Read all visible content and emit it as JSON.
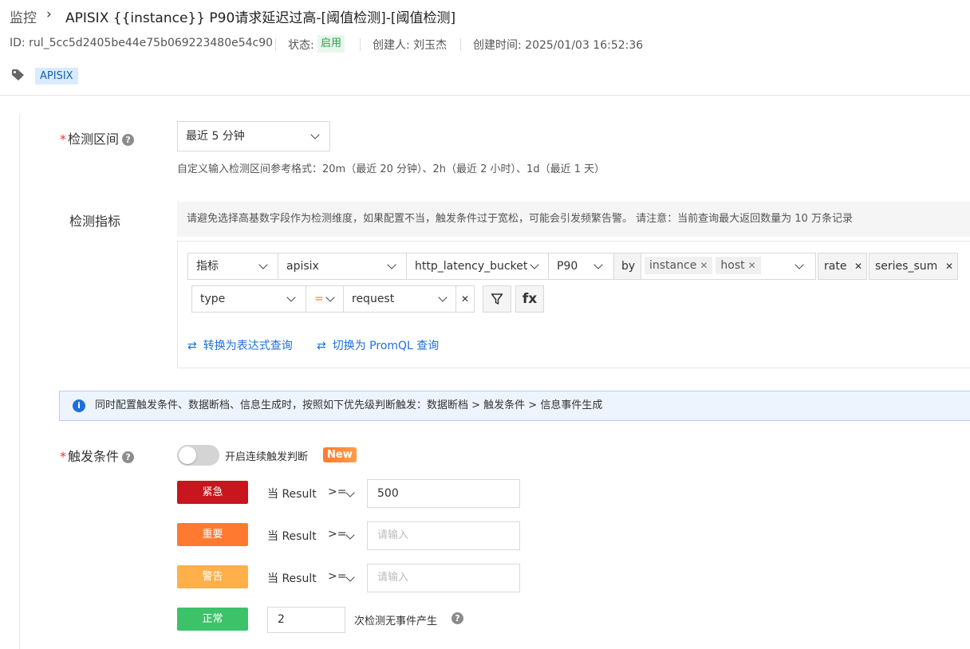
{
  "header": {
    "breadcrumb_parent": "监控",
    "title": "APISIX {{instance}} P90请求延迟过高-[阈值检测]-[阈值检测]",
    "id_text": "ID: rul_5cc5d2405be44e75b069223480e54c90",
    "status_label": "状态:",
    "status_value": "启用",
    "creator": "创建人: 刘玉杰",
    "created_time": "创建时间: 2025/01/03 16:52:36",
    "tag": "APISIX"
  },
  "detect_range": {
    "label": "检测区间",
    "value": "最近 5 分钟",
    "hint": "自定义输入检测区间参考格式：20m（最近 20 分钟）、2h（最近 2 小时）、1d（最近 1 天）"
  },
  "metrics": {
    "label": "检测指标",
    "notice": "请避免选择高基数字段作为检测维度，如果配置不当，触发条件过于宽松，可能会引发频繁告警。 请注意：当前查询最大返回数量为 10 万条记录",
    "query_type": "指标",
    "source": "apisix",
    "metric": "http_latency_bucket",
    "agg": "P90",
    "by_label": "by",
    "by_tags": [
      "instance",
      "host"
    ],
    "fn1": "rate",
    "fn2": "series_sum",
    "filter_field": "type",
    "filter_op": "=",
    "filter_value": "request",
    "filter_icon": "filter-icon",
    "fx_label": "fx",
    "link_expression": "转换为表达式查询",
    "link_promql": "切换为 PromQL 查询"
  },
  "info": {
    "text": "同时配置触发条件、数据断档、信息生成时，按照如下优先级判断触发：数据断档 > 触发条件 > 信息事件生成"
  },
  "trigger": {
    "label": "触发条件",
    "toggle_label": "开启连续触发判断",
    "new_badge": "New",
    "toggle_on": false,
    "rows": [
      {
        "level": "紧急",
        "color": "#c9151e",
        "cond": "当 Result",
        "op": ">=",
        "value": "500",
        "placeholder": ""
      },
      {
        "level": "重要",
        "color": "#ff7a30",
        "cond": "当 Result",
        "op": ">=",
        "value": "",
        "placeholder": "请输入"
      },
      {
        "level": "警告",
        "color": "#ffb04a",
        "cond": "当 Result",
        "op": ">=",
        "value": "",
        "placeholder": "请输入"
      }
    ],
    "normal": {
      "level": "正常",
      "color": "#3cc36a",
      "count": "2",
      "suffix": "次检测无事件产生"
    }
  }
}
